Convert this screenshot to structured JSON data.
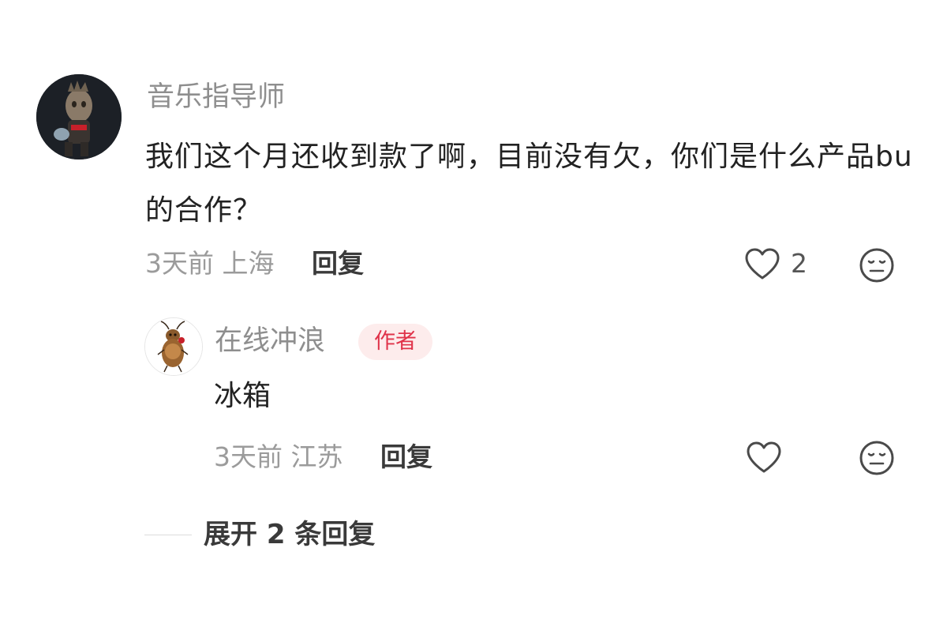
{
  "comment": {
    "username": "音乐指导师",
    "text": "我们这个月还收到款了啊，目前没有欠，你们是什么产品bu的合作？",
    "meta": "3天前 上海",
    "reply_label": "回复",
    "like_count": "2",
    "icons": {
      "like": "heart-outline-icon",
      "emoji": "neutral-face-icon"
    }
  },
  "reply": {
    "username": "在线冲浪",
    "badge": "作者",
    "text": "冰箱",
    "meta": "3天前 江苏",
    "reply_label": "回复",
    "icons": {
      "like": "heart-outline-icon",
      "emoji": "neutral-face-icon"
    }
  },
  "expand": {
    "label": "展开 2 条回复"
  },
  "colors": {
    "username": "#8e8e8e",
    "text": "#222222",
    "meta": "#9b9b9b",
    "badge_bg": "#fdecec",
    "badge_text": "#e0334a"
  }
}
